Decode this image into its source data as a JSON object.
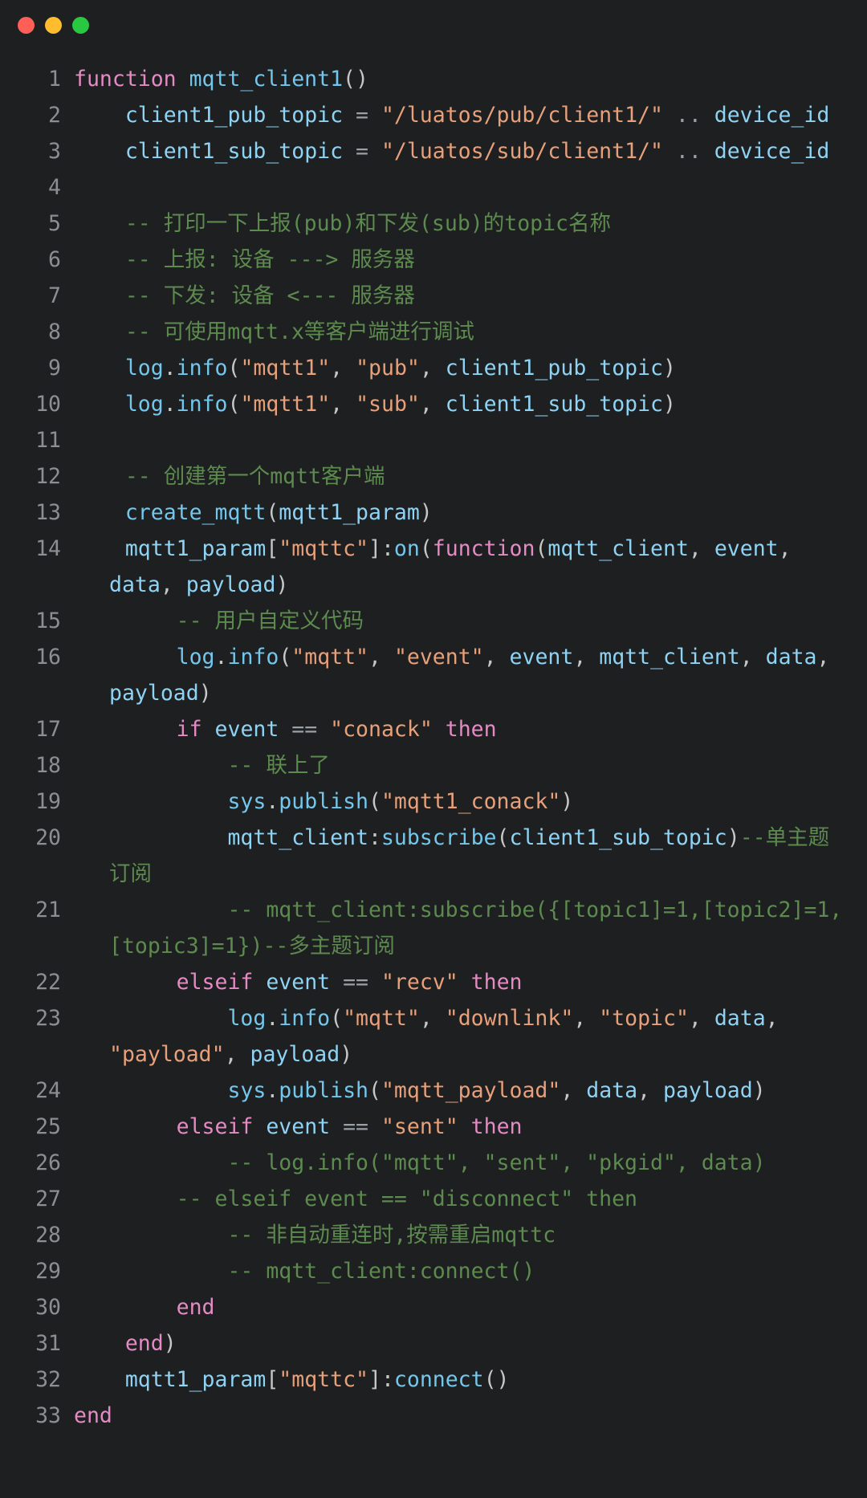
{
  "window": {
    "traffic_lights": [
      {
        "name": "close",
        "color": "#ff5f57"
      },
      {
        "name": "minimize",
        "color": "#febc2e"
      },
      {
        "name": "zoom",
        "color": "#28c840"
      }
    ]
  },
  "editor": {
    "language": "lua",
    "theme_background": "#1d1f21",
    "gutter_color": "#8a8f93",
    "colors": {
      "keyword": "#e48bc4",
      "string": "#e8a07a",
      "identifier": "#74c7ec",
      "variable": "#8fd3f4",
      "comment": "#5d8a4e",
      "punctuation": "#c5c8c6",
      "operator": "#9aa0a6"
    },
    "line_numbers": [
      1,
      2,
      3,
      4,
      5,
      6,
      7,
      8,
      9,
      10,
      11,
      12,
      13,
      14,
      15,
      16,
      17,
      18,
      19,
      20,
      21,
      22,
      23,
      24,
      25,
      26,
      27,
      28,
      29,
      30,
      31,
      32,
      33
    ],
    "lines": [
      {
        "n": "1",
        "text": "function mqtt_client1()",
        "tokens": [
          {
            "t": "function ",
            "c": "kw"
          },
          {
            "t": "mqtt_client1",
            "c": "id"
          },
          {
            "t": "()",
            "c": "punct"
          }
        ]
      },
      {
        "n": "2",
        "text": "    client1_pub_topic = \"/luatos/pub/client1/\" .. device_id",
        "tokens": [
          {
            "t": "    ",
            "c": "plain"
          },
          {
            "t": "client1_pub_topic",
            "c": "var"
          },
          {
            "t": " = ",
            "c": "op"
          },
          {
            "t": "\"/luatos/pub/client1/\"",
            "c": "str"
          },
          {
            "t": " .. ",
            "c": "op"
          },
          {
            "t": "device_id",
            "c": "var"
          }
        ]
      },
      {
        "n": "3",
        "text": "    client1_sub_topic = \"/luatos/sub/client1/\" .. device_id",
        "tokens": [
          {
            "t": "    ",
            "c": "plain"
          },
          {
            "t": "client1_sub_topic",
            "c": "var"
          },
          {
            "t": " = ",
            "c": "op"
          },
          {
            "t": "\"/luatos/sub/client1/\"",
            "c": "str"
          },
          {
            "t": " .. ",
            "c": "op"
          },
          {
            "t": "device_id",
            "c": "var"
          }
        ]
      },
      {
        "n": "4",
        "text": "",
        "tokens": []
      },
      {
        "n": "5",
        "text": "    -- 打印一下上报(pub)和下发(sub)的topic名称",
        "tokens": [
          {
            "t": "    ",
            "c": "plain"
          },
          {
            "t": "-- 打印一下上报(pub)和下发(sub)的topic名称",
            "c": "com"
          }
        ]
      },
      {
        "n": "6",
        "text": "    -- 上报: 设备 ---> 服务器",
        "tokens": [
          {
            "t": "    ",
            "c": "plain"
          },
          {
            "t": "-- 上报: 设备 ---> 服务器",
            "c": "com"
          }
        ]
      },
      {
        "n": "7",
        "text": "    -- 下发: 设备 <--- 服务器",
        "tokens": [
          {
            "t": "    ",
            "c": "plain"
          },
          {
            "t": "-- 下发: 设备 <--- 服务器",
            "c": "com"
          }
        ]
      },
      {
        "n": "8",
        "text": "    -- 可使用mqtt.x等客户端进行调试",
        "tokens": [
          {
            "t": "    ",
            "c": "plain"
          },
          {
            "t": "-- 可使用mqtt.x等客户端进行调试",
            "c": "com"
          }
        ]
      },
      {
        "n": "9",
        "text": "    log.info(\"mqtt1\", \"pub\", client1_pub_topic)",
        "tokens": [
          {
            "t": "    ",
            "c": "plain"
          },
          {
            "t": "log",
            "c": "id"
          },
          {
            "t": ".",
            "c": "punct"
          },
          {
            "t": "info",
            "c": "id"
          },
          {
            "t": "(",
            "c": "punct"
          },
          {
            "t": "\"mqtt1\"",
            "c": "str"
          },
          {
            "t": ", ",
            "c": "punct"
          },
          {
            "t": "\"pub\"",
            "c": "str"
          },
          {
            "t": ", ",
            "c": "punct"
          },
          {
            "t": "client1_pub_topic",
            "c": "var"
          },
          {
            "t": ")",
            "c": "punct"
          }
        ]
      },
      {
        "n": "10",
        "text": "    log.info(\"mqtt1\", \"sub\", client1_sub_topic)",
        "tokens": [
          {
            "t": "    ",
            "c": "plain"
          },
          {
            "t": "log",
            "c": "id"
          },
          {
            "t": ".",
            "c": "punct"
          },
          {
            "t": "info",
            "c": "id"
          },
          {
            "t": "(",
            "c": "punct"
          },
          {
            "t": "\"mqtt1\"",
            "c": "str"
          },
          {
            "t": ", ",
            "c": "punct"
          },
          {
            "t": "\"sub\"",
            "c": "str"
          },
          {
            "t": ", ",
            "c": "punct"
          },
          {
            "t": "client1_sub_topic",
            "c": "var"
          },
          {
            "t": ")",
            "c": "punct"
          }
        ]
      },
      {
        "n": "11",
        "text": "",
        "tokens": []
      },
      {
        "n": "12",
        "text": "    -- 创建第一个mqtt客户端",
        "tokens": [
          {
            "t": "    ",
            "c": "plain"
          },
          {
            "t": "-- 创建第一个mqtt客户端",
            "c": "com"
          }
        ]
      },
      {
        "n": "13",
        "text": "    create_mqtt(mqtt1_param)",
        "tokens": [
          {
            "t": "    ",
            "c": "plain"
          },
          {
            "t": "create_mqtt",
            "c": "id"
          },
          {
            "t": "(",
            "c": "punct"
          },
          {
            "t": "mqtt1_param",
            "c": "var"
          },
          {
            "t": ")",
            "c": "punct"
          }
        ]
      },
      {
        "n": "14",
        "text": "    mqtt1_param[\"mqttc\"]:on(function(mqtt_client, event, data, payload)",
        "tokens": [
          {
            "t": "    ",
            "c": "plain"
          },
          {
            "t": "mqtt1_param",
            "c": "var"
          },
          {
            "t": "[",
            "c": "punct"
          },
          {
            "t": "\"mqttc\"",
            "c": "str"
          },
          {
            "t": "]:",
            "c": "punct"
          },
          {
            "t": "on",
            "c": "id"
          },
          {
            "t": "(",
            "c": "punct"
          },
          {
            "t": "function",
            "c": "kw"
          },
          {
            "t": "(",
            "c": "punct"
          },
          {
            "t": "mqtt_client",
            "c": "var"
          },
          {
            "t": ", ",
            "c": "punct"
          },
          {
            "t": "event",
            "c": "var"
          },
          {
            "t": ", ",
            "c": "punct"
          },
          {
            "t": "data",
            "c": "var"
          },
          {
            "t": ", ",
            "c": "punct"
          },
          {
            "t": "payload",
            "c": "var"
          },
          {
            "t": ")",
            "c": "punct"
          }
        ]
      },
      {
        "n": "15",
        "text": "        -- 用户自定义代码",
        "tokens": [
          {
            "t": "        ",
            "c": "plain"
          },
          {
            "t": "-- 用户自定义代码",
            "c": "com"
          }
        ]
      },
      {
        "n": "16",
        "text": "        log.info(\"mqtt\", \"event\", event, mqtt_client, data, payload)",
        "tokens": [
          {
            "t": "        ",
            "c": "plain"
          },
          {
            "t": "log",
            "c": "id"
          },
          {
            "t": ".",
            "c": "punct"
          },
          {
            "t": "info",
            "c": "id"
          },
          {
            "t": "(",
            "c": "punct"
          },
          {
            "t": "\"mqtt\"",
            "c": "str"
          },
          {
            "t": ", ",
            "c": "punct"
          },
          {
            "t": "\"event\"",
            "c": "str"
          },
          {
            "t": ", ",
            "c": "punct"
          },
          {
            "t": "event",
            "c": "var"
          },
          {
            "t": ", ",
            "c": "punct"
          },
          {
            "t": "mqtt_client",
            "c": "var"
          },
          {
            "t": ", ",
            "c": "punct"
          },
          {
            "t": "data",
            "c": "var"
          },
          {
            "t": ", ",
            "c": "punct"
          },
          {
            "t": "payload",
            "c": "var"
          },
          {
            "t": ")",
            "c": "punct"
          }
        ]
      },
      {
        "n": "17",
        "text": "        if event == \"conack\" then",
        "tokens": [
          {
            "t": "        ",
            "c": "plain"
          },
          {
            "t": "if",
            "c": "kw"
          },
          {
            "t": " ",
            "c": "plain"
          },
          {
            "t": "event",
            "c": "var"
          },
          {
            "t": " == ",
            "c": "op"
          },
          {
            "t": "\"conack\"",
            "c": "str"
          },
          {
            "t": " ",
            "c": "plain"
          },
          {
            "t": "then",
            "c": "kw"
          }
        ]
      },
      {
        "n": "18",
        "text": "            -- 联上了",
        "tokens": [
          {
            "t": "            ",
            "c": "plain"
          },
          {
            "t": "-- 联上了",
            "c": "com"
          }
        ]
      },
      {
        "n": "19",
        "text": "            sys.publish(\"mqtt1_conack\")",
        "tokens": [
          {
            "t": "            ",
            "c": "plain"
          },
          {
            "t": "sys",
            "c": "id"
          },
          {
            "t": ".",
            "c": "punct"
          },
          {
            "t": "publish",
            "c": "id"
          },
          {
            "t": "(",
            "c": "punct"
          },
          {
            "t": "\"mqtt1_conack\"",
            "c": "str"
          },
          {
            "t": ")",
            "c": "punct"
          }
        ]
      },
      {
        "n": "20",
        "text": "            mqtt_client:subscribe(client1_sub_topic)--单主题订阅",
        "tokens": [
          {
            "t": "            ",
            "c": "plain"
          },
          {
            "t": "mqtt_client",
            "c": "var"
          },
          {
            "t": ":",
            "c": "punct"
          },
          {
            "t": "subscribe",
            "c": "id"
          },
          {
            "t": "(",
            "c": "punct"
          },
          {
            "t": "client1_sub_topic",
            "c": "var"
          },
          {
            "t": ")",
            "c": "punct"
          },
          {
            "t": "--单主题订阅",
            "c": "com"
          }
        ]
      },
      {
        "n": "21",
        "text": "            -- mqtt_client:subscribe({[topic1]=1,[topic2]=1,[topic3]=1})--多主题订阅",
        "tokens": [
          {
            "t": "            ",
            "c": "plain"
          },
          {
            "t": "-- mqtt_client:subscribe({[topic1]=1,[topic2]=1,[topic3]=1})--多主题订阅",
            "c": "com"
          }
        ]
      },
      {
        "n": "22",
        "text": "        elseif event == \"recv\" then",
        "tokens": [
          {
            "t": "        ",
            "c": "plain"
          },
          {
            "t": "elseif",
            "c": "kw"
          },
          {
            "t": " ",
            "c": "plain"
          },
          {
            "t": "event",
            "c": "var"
          },
          {
            "t": " == ",
            "c": "op"
          },
          {
            "t": "\"recv\"",
            "c": "str"
          },
          {
            "t": " ",
            "c": "plain"
          },
          {
            "t": "then",
            "c": "kw"
          }
        ]
      },
      {
        "n": "23",
        "text": "            log.info(\"mqtt\", \"downlink\", \"topic\", data, \"payload\", payload)",
        "tokens": [
          {
            "t": "            ",
            "c": "plain"
          },
          {
            "t": "log",
            "c": "id"
          },
          {
            "t": ".",
            "c": "punct"
          },
          {
            "t": "info",
            "c": "id"
          },
          {
            "t": "(",
            "c": "punct"
          },
          {
            "t": "\"mqtt\"",
            "c": "str"
          },
          {
            "t": ", ",
            "c": "punct"
          },
          {
            "t": "\"downlink\"",
            "c": "str"
          },
          {
            "t": ", ",
            "c": "punct"
          },
          {
            "t": "\"topic\"",
            "c": "str"
          },
          {
            "t": ", ",
            "c": "punct"
          },
          {
            "t": "data",
            "c": "var"
          },
          {
            "t": ", ",
            "c": "punct"
          },
          {
            "t": "\"payload\"",
            "c": "str"
          },
          {
            "t": ", ",
            "c": "punct"
          },
          {
            "t": "payload",
            "c": "var"
          },
          {
            "t": ")",
            "c": "punct"
          }
        ]
      },
      {
        "n": "24",
        "text": "            sys.publish(\"mqtt_payload\", data, payload)",
        "tokens": [
          {
            "t": "            ",
            "c": "plain"
          },
          {
            "t": "sys",
            "c": "id"
          },
          {
            "t": ".",
            "c": "punct"
          },
          {
            "t": "publish",
            "c": "id"
          },
          {
            "t": "(",
            "c": "punct"
          },
          {
            "t": "\"mqtt_payload\"",
            "c": "str"
          },
          {
            "t": ", ",
            "c": "punct"
          },
          {
            "t": "data",
            "c": "var"
          },
          {
            "t": ", ",
            "c": "punct"
          },
          {
            "t": "payload",
            "c": "var"
          },
          {
            "t": ")",
            "c": "punct"
          }
        ]
      },
      {
        "n": "25",
        "text": "        elseif event == \"sent\" then",
        "tokens": [
          {
            "t": "        ",
            "c": "plain"
          },
          {
            "t": "elseif",
            "c": "kw"
          },
          {
            "t": " ",
            "c": "plain"
          },
          {
            "t": "event",
            "c": "var"
          },
          {
            "t": " == ",
            "c": "op"
          },
          {
            "t": "\"sent\"",
            "c": "str"
          },
          {
            "t": " ",
            "c": "plain"
          },
          {
            "t": "then",
            "c": "kw"
          }
        ]
      },
      {
        "n": "26",
        "text": "            -- log.info(\"mqtt\", \"sent\", \"pkgid\", data)",
        "tokens": [
          {
            "t": "            ",
            "c": "plain"
          },
          {
            "t": "-- log.info(\"mqtt\", \"sent\", \"pkgid\", data)",
            "c": "com"
          }
        ]
      },
      {
        "n": "27",
        "text": "        -- elseif event == \"disconnect\" then",
        "tokens": [
          {
            "t": "        ",
            "c": "plain"
          },
          {
            "t": "-- elseif event == \"disconnect\" then",
            "c": "com"
          }
        ]
      },
      {
        "n": "28",
        "text": "            -- 非自动重连时,按需重启mqttc",
        "tokens": [
          {
            "t": "            ",
            "c": "plain"
          },
          {
            "t": "-- 非自动重连时,按需重启mqttc",
            "c": "com"
          }
        ]
      },
      {
        "n": "29",
        "text": "            -- mqtt_client:connect()",
        "tokens": [
          {
            "t": "            ",
            "c": "plain"
          },
          {
            "t": "-- mqtt_client:connect()",
            "c": "com"
          }
        ]
      },
      {
        "n": "30",
        "text": "        end",
        "tokens": [
          {
            "t": "        ",
            "c": "plain"
          },
          {
            "t": "end",
            "c": "kw"
          }
        ]
      },
      {
        "n": "31",
        "text": "    end)",
        "tokens": [
          {
            "t": "    ",
            "c": "plain"
          },
          {
            "t": "end",
            "c": "kw"
          },
          {
            "t": ")",
            "c": "punct"
          }
        ]
      },
      {
        "n": "32",
        "text": "    mqtt1_param[\"mqttc\"]:connect()",
        "tokens": [
          {
            "t": "    ",
            "c": "plain"
          },
          {
            "t": "mqtt1_param",
            "c": "var"
          },
          {
            "t": "[",
            "c": "punct"
          },
          {
            "t": "\"mqttc\"",
            "c": "str"
          },
          {
            "t": "]:",
            "c": "punct"
          },
          {
            "t": "connect",
            "c": "id"
          },
          {
            "t": "()",
            "c": "punct"
          }
        ]
      },
      {
        "n": "33",
        "text": "end",
        "tokens": [
          {
            "t": "end",
            "c": "kw"
          }
        ]
      }
    ]
  }
}
